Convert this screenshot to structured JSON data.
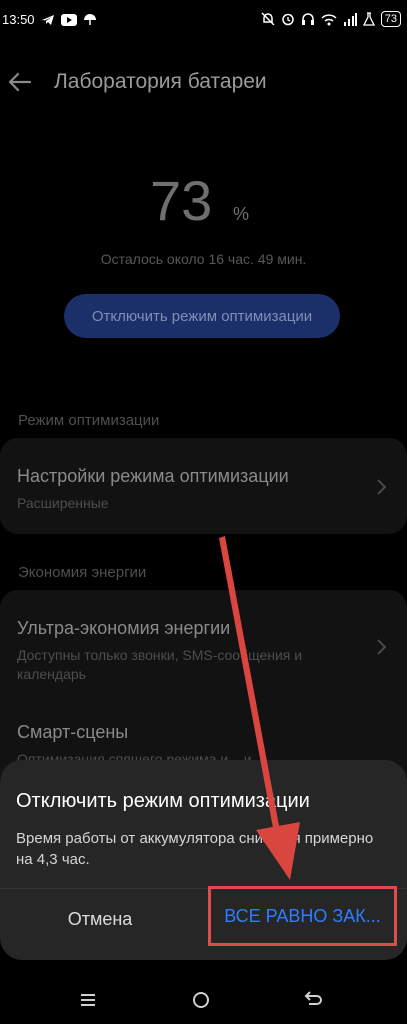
{
  "status_bar": {
    "time": "13:50",
    "battery": "73",
    "icons": [
      "telegram-icon",
      "youtube-icon",
      "umbrella-icon",
      "mute-icon",
      "alarm-icon",
      "headphones-icon",
      "wifi-icon",
      "signal-icon",
      "lab-icon",
      "battery-icon"
    ]
  },
  "app_bar": {
    "title": "Лаборатория батареи",
    "back_icon": "back-arrow-icon"
  },
  "battery": {
    "percent": "73",
    "percent_sign": "%",
    "remaining": "Осталось около 16 час.  49 мин."
  },
  "disable_button": "Отключить режим оптимизации",
  "sections": {
    "optimization": {
      "header": "Режим оптимизации",
      "items": [
        {
          "title": "Настройки режима оптимизации",
          "subtitle": "Расширенные"
        }
      ]
    },
    "energy": {
      "header": "Экономия энергии",
      "items": [
        {
          "title": "Ультра-экономия энергии",
          "subtitle": "Доступны только звонки, SMS-сообщения и календарь"
        },
        {
          "title": "Смарт-сцены",
          "subtitle": "Оптимизация спящего режима и ...и"
        }
      ]
    }
  },
  "dialog": {
    "title": "Отключить режим оптимизации",
    "message": "Время работы от аккумулятора снизится примерно на 4,3 час.",
    "cancel": "Отмена",
    "confirm": "ВСЕ РАВНО ЗАК..."
  },
  "nav_bar": {
    "icons": [
      "menu-icon",
      "home-icon",
      "back-icon"
    ]
  },
  "colors": {
    "accent": "#2f7dff",
    "highlight": "#e04b4b",
    "button_bg": "#1b2f68",
    "background": "#000000",
    "dialog_bg": "#262626"
  }
}
